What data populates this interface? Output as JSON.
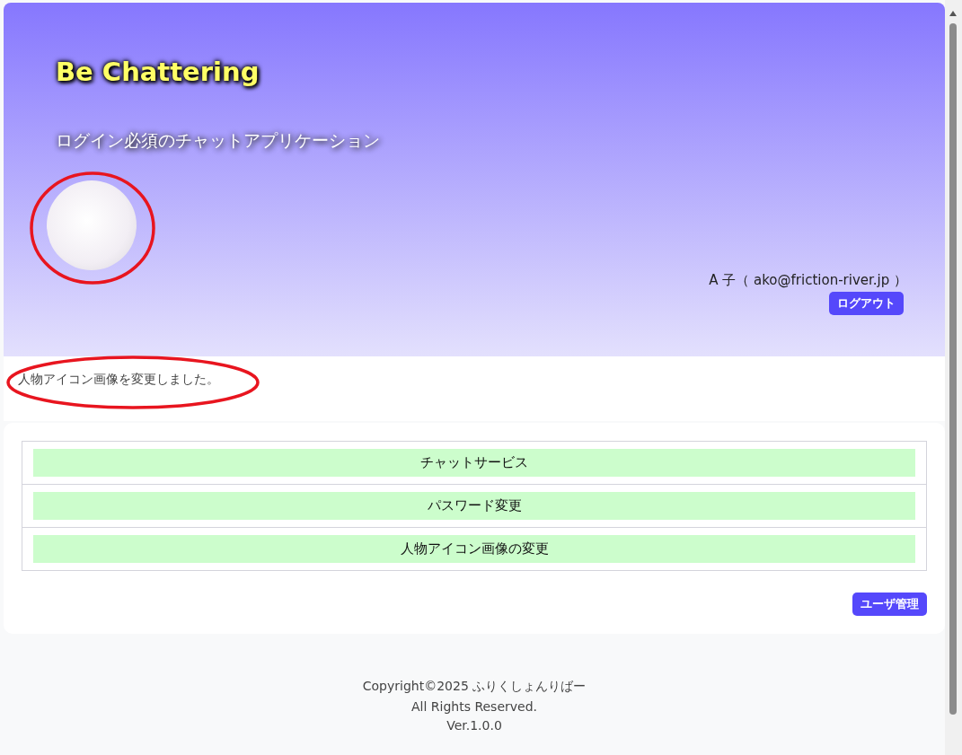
{
  "header": {
    "title": "Be Chattering",
    "subtitle": "ログイン必須のチャットアプリケーション",
    "user": "A 子（ ako@friction-river.jp ）",
    "logout_button": "ログアウト"
  },
  "notice": "人物アイコン画像を変更しました。",
  "menu": [
    {
      "label": "チャットサービス"
    },
    {
      "label": "パスワード変更"
    },
    {
      "label": "人物アイコン画像の変更"
    }
  ],
  "admin_button": "ユーザ管理",
  "footer": [
    "Copyright©2025 ふりくしょんりばー",
    "All Rights Reserved.",
    "Ver.1.0.0"
  ]
}
